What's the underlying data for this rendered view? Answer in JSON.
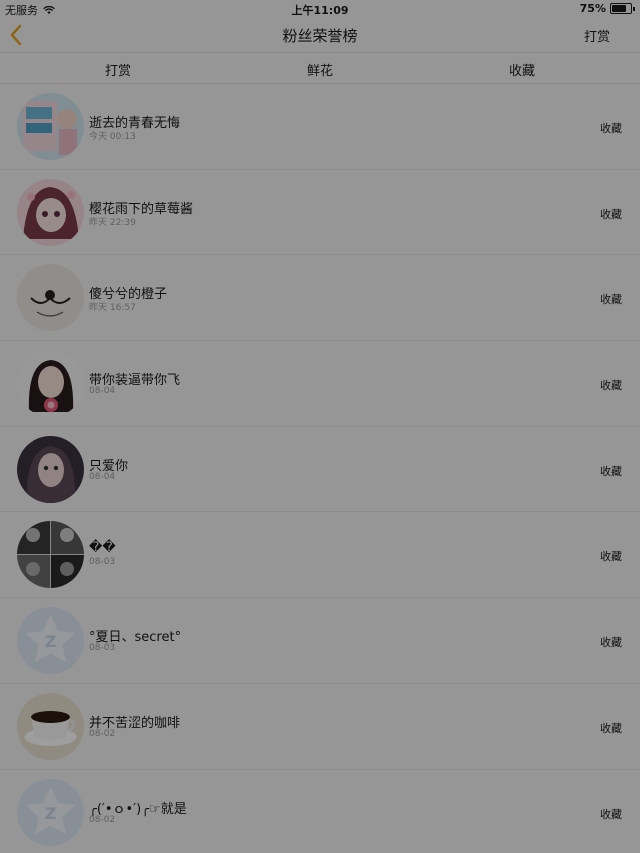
{
  "status_bar": {
    "carrier": "无服务",
    "time": "上午11:09",
    "battery": "75%",
    "battery_level": 0.75
  },
  "nav": {
    "title": "粉丝荣誉榜",
    "right_label": "打赏",
    "back_icon": "chevron-left-icon"
  },
  "tabs": [
    {
      "label": "打赏",
      "active": false
    },
    {
      "label": "鲜花",
      "active": false
    },
    {
      "label": "收藏",
      "active": true
    }
  ],
  "colors": {
    "accent": "#e2a017",
    "text": "#1a1a1a",
    "secondary": "#9a9a9a",
    "background": "#f2f2f2"
  },
  "fans": [
    {
      "name": "逝去的青春无悔",
      "time": "今天 00:13",
      "action": "收藏",
      "avatar": "photo"
    },
    {
      "name": "樱花雨下的草莓酱",
      "time": "昨天 22:39",
      "action": "收藏",
      "avatar": "anime-girl"
    },
    {
      "name": "傻兮兮的橙子",
      "time": "昨天 16:57",
      "action": "收藏",
      "avatar": "doodle"
    },
    {
      "name": "带你装逼带你飞",
      "time": "08-04",
      "action": "收藏",
      "avatar": "girl-lollipop"
    },
    {
      "name": "只爱你",
      "time": "08-04",
      "action": "收藏",
      "avatar": "portrait"
    },
    {
      "name": "��",
      "time": "08-03",
      "action": "收藏",
      "avatar": "collage"
    },
    {
      "name": "°夏日、secret°",
      "time": "08-03",
      "action": "收藏",
      "avatar": "default-star"
    },
    {
      "name": "并不苦涩的咖啡",
      "time": "08-02",
      "action": "收藏",
      "avatar": "coffee"
    },
    {
      "name": "╭(′•ｏ•′)╭☞就是",
      "time": "08-02",
      "action": "收藏",
      "avatar": "default-star"
    }
  ]
}
